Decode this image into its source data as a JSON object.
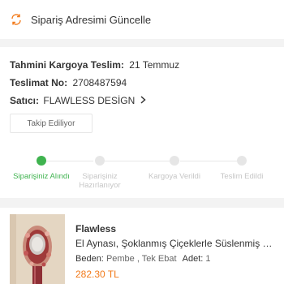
{
  "update_address": {
    "label": "Sipariş Adresimi Güncelle",
    "icon": "refresh-icon"
  },
  "shipping": {
    "estimated_label": "Tahmini Kargoya Teslim:",
    "estimated_value": "21 Temmuz",
    "delivery_no_label": "Teslimat No:",
    "delivery_no_value": "2708487594",
    "seller_label": "Satıcı:",
    "seller_value": "FLAWLESS DESİGN"
  },
  "follow_button": {
    "label": "Takip Ediliyor"
  },
  "steps": [
    {
      "label": "Siparişiniz Alındı",
      "active": true
    },
    {
      "label": "Siparişiniz Hazırlanıyor",
      "active": false
    },
    {
      "label": "Kargoya Verildi",
      "active": false
    },
    {
      "label": "Teslim Edildi",
      "active": false
    }
  ],
  "product": {
    "brand": "Flawless",
    "name": "El Aynası, Şoklanmış Çiçeklerle Süslenmiş El A...",
    "size_label": "Beden:",
    "size_value": "Pembe , Tek Ebat",
    "qty_label": "Adet:",
    "qty_value": "1",
    "price": "282.30 TL"
  },
  "colors": {
    "accent_green": "#3fb34f",
    "price_orange": "#f27a1a"
  }
}
